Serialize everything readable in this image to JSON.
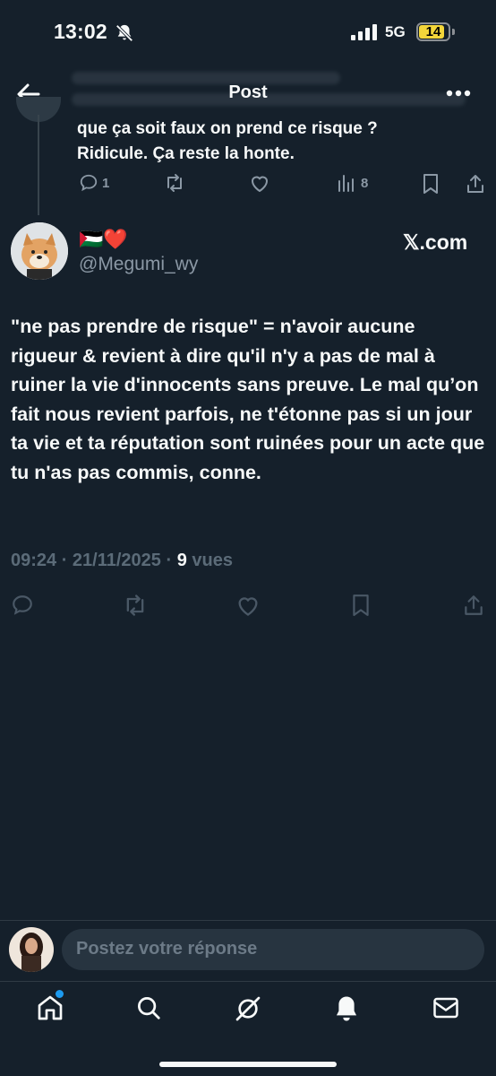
{
  "status_bar": {
    "time": "13:02",
    "network": "5G",
    "battery": "14",
    "icons": [
      "bell-off-icon",
      "signal-icon",
      "battery-icon"
    ]
  },
  "header": {
    "title": "Post",
    "icons": [
      "back-arrow-icon",
      "more-icon"
    ]
  },
  "parent_post": {
    "text_line1": "que ça soit faux on prend ce risque ?",
    "text_line2": "Ridicule. Ça reste la honte.",
    "replies": "1",
    "views": "8"
  },
  "post": {
    "display_name": "🇵🇸❤️",
    "handle": "@Megumi_wy",
    "watermark": "𝕏.com",
    "body": "\"ne pas prendre de risque\" = n'avoir aucune rigueur & revient à dire qu'il n'y a pas de mal à ruiner la vie d'innocents sans preuve. Le mal qu’on fait nous revient parfois, ne t'étonne pas si un jour ta vie et ta réputation sont ruinées pour un acte que tu n'as pas commis, conne.",
    "timestamp": "09:24 · 21/11/2025 · ",
    "views_count": "9",
    "views_label": " vues"
  },
  "reply": {
    "placeholder": "Postez votre réponse"
  },
  "bottom_nav": {
    "items": [
      "home-icon",
      "search-icon",
      "grok-icon",
      "notifications-icon",
      "messages-icon"
    ],
    "accent_color": "#1d9bf0"
  },
  "colors": {
    "background": "#15202b",
    "text": "#f7f9f9",
    "secondary": "#8b98a5"
  }
}
